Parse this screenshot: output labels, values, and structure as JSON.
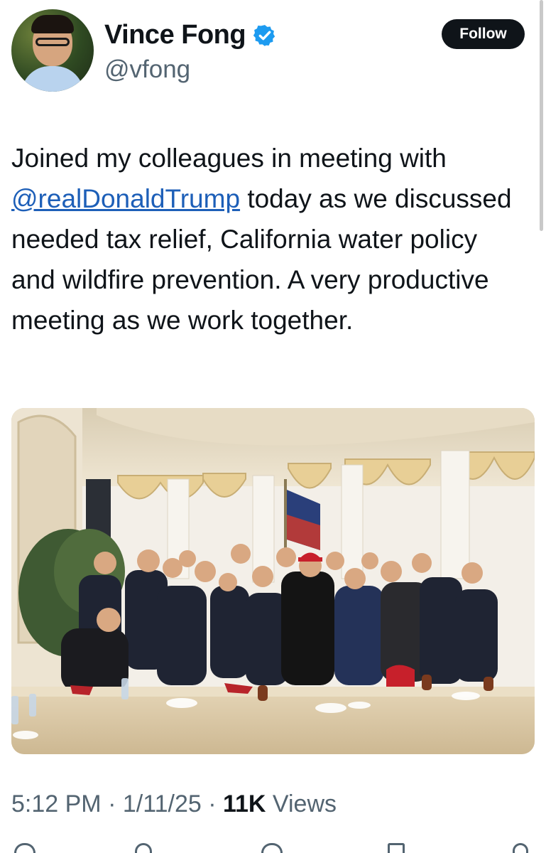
{
  "author": {
    "name": "Vince Fong",
    "handle": "@vfong",
    "verified": true
  },
  "follow_button": "Follow",
  "tweet": {
    "text_before": "Joined my colleagues in meeting with ",
    "mention": "@realDonaldTrump",
    "text_after": " today as we discussed needed tax relief, California water policy and wildfire prevention. A very productive meeting as we work together."
  },
  "meta": {
    "time": "5:12 PM",
    "separator": " · ",
    "date": "1/11/25",
    "views_count": "11K",
    "views_label": " Views"
  },
  "colors": {
    "text": "#0f1419",
    "secondary": "#536471",
    "verified": "#1d9bf0",
    "mention": "#1d5fb8"
  },
  "icons": [
    "verified-badge-icon",
    "reply-icon",
    "retweet-icon",
    "like-icon",
    "bookmark-icon",
    "share-icon"
  ]
}
